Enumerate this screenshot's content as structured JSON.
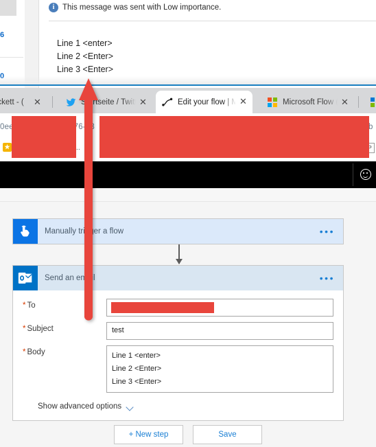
{
  "outlook_preview": {
    "info_icon": "info-icon",
    "info_text": "This message was sent with Low importance.",
    "body_lines": [
      "Line 1 <enter>",
      "Line 2 <Enter>",
      "Line 3 <Enter>"
    ],
    "list_counts": [
      "6",
      "0"
    ]
  },
  "browser": {
    "tabs": [
      {
        "title": "ackett - (",
        "favicon": "none-icon",
        "active": false
      },
      {
        "title": "Startseite / Twitt",
        "favicon": "twitter-icon",
        "active": false
      },
      {
        "title": "Edit your flow | M",
        "favicon": "microsoft-flow-icon",
        "active": true
      },
      {
        "title": "Microsoft Flow (",
        "favicon": "microsoft-logo-icon",
        "active": false
      }
    ],
    "close_glyph": "✕",
    "url_left": "0ee",
    "url_mid": "476-23",
    "url_right": "b",
    "bookmark_icon": "bookmark-star-icon",
    "bookmark_label": "s  e...",
    "bookmark_right_icon": "P",
    "redactions": [
      "url-redaction-left",
      "url-redaction-right"
    ]
  },
  "app_header": {
    "feedback_icon": "smiley-face-icon"
  },
  "flow": {
    "trigger_card": {
      "title": "Manually trigger a flow",
      "icon": "touch-hand-icon",
      "menu": "• • •"
    },
    "action_card": {
      "title": "Send an email",
      "icon": "outlook-icon",
      "menu": "• • •",
      "fields": [
        {
          "label": "To",
          "required": true,
          "value": "",
          "redacted": true
        },
        {
          "label": "Subject",
          "required": true,
          "value": "test",
          "redacted": false
        },
        {
          "label": "Body",
          "required": true,
          "value": "Line 1 <enter>\nLine 2 <Enter>\nLine 3 <Enter>",
          "redacted": false
        }
      ],
      "advanced_label": "Show advanced options",
      "advanced_chevron": "chevron-down-icon"
    },
    "buttons": {
      "new_step": "+ New step",
      "save": "Save"
    }
  },
  "annotation": {
    "type": "up-arrow",
    "color": "#e8453c"
  },
  "colors": {
    "annotation_red": "#e8453c",
    "flow_blue": "#0b74e5",
    "outlook_blue": "#0072c6",
    "card_header_blue": "#dbe9fa",
    "link_blue": "#1a7fd4",
    "canvas_gray": "#f5f5f5",
    "required_orange": "#d83b01"
  }
}
